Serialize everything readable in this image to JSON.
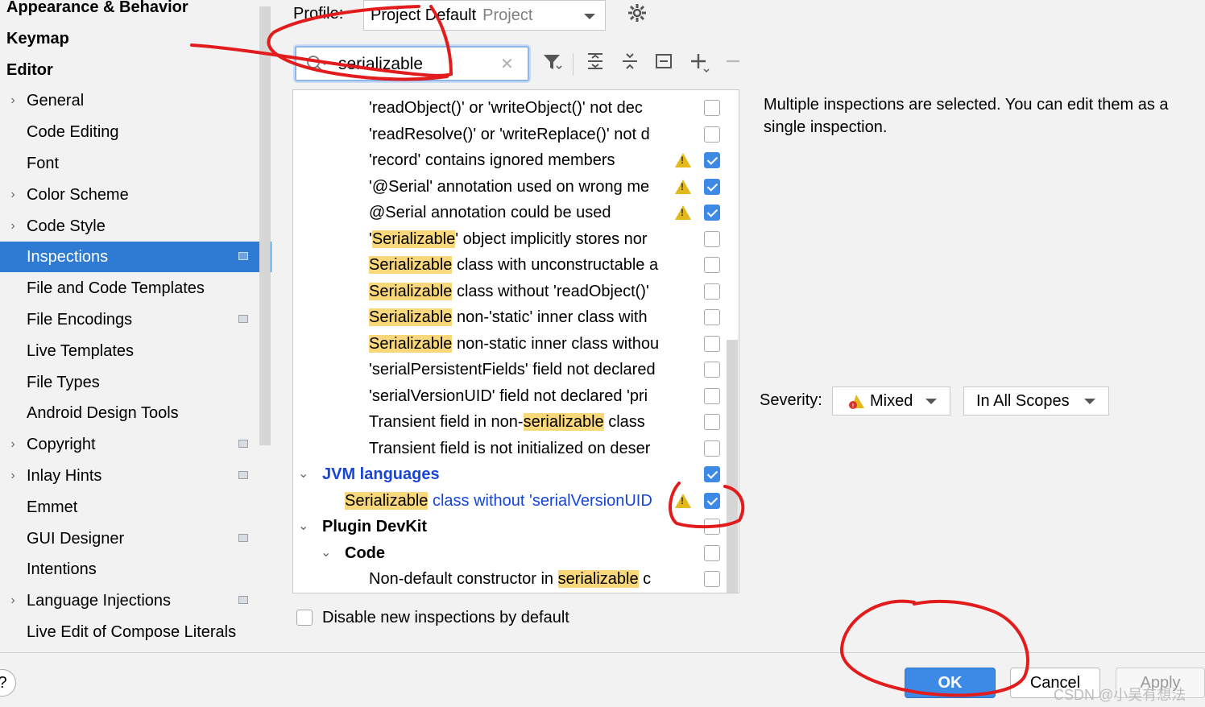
{
  "sidebar": {
    "items": [
      {
        "label": "Appearance & Behavior",
        "level": "top",
        "arrow": "",
        "badge": false
      },
      {
        "label": "Keymap",
        "level": "top",
        "arrow": "",
        "badge": false
      },
      {
        "label": "Editor",
        "level": "top",
        "arrow": "",
        "badge": false
      },
      {
        "label": "General",
        "level": "child",
        "arrow": "›",
        "badge": false
      },
      {
        "label": "Code Editing",
        "level": "child",
        "arrow": "",
        "badge": false
      },
      {
        "label": "Font",
        "level": "child",
        "arrow": "",
        "badge": false
      },
      {
        "label": "Color Scheme",
        "level": "child",
        "arrow": "›",
        "badge": false
      },
      {
        "label": "Code Style",
        "level": "child",
        "arrow": "›",
        "badge": false
      },
      {
        "label": "Inspections",
        "level": "child",
        "arrow": "",
        "badge": true,
        "selected": true
      },
      {
        "label": "File and Code Templates",
        "level": "child",
        "arrow": "",
        "badge": false
      },
      {
        "label": "File Encodings",
        "level": "child",
        "arrow": "",
        "badge": true
      },
      {
        "label": "Live Templates",
        "level": "child",
        "arrow": "",
        "badge": false
      },
      {
        "label": "File Types",
        "level": "child",
        "arrow": "",
        "badge": false
      },
      {
        "label": "Android Design Tools",
        "level": "child",
        "arrow": "",
        "badge": false
      },
      {
        "label": "Copyright",
        "level": "child",
        "arrow": "›",
        "badge": true
      },
      {
        "label": "Inlay Hints",
        "level": "child",
        "arrow": "›",
        "badge": true
      },
      {
        "label": "Emmet",
        "level": "child",
        "arrow": "",
        "badge": false
      },
      {
        "label": "GUI Designer",
        "level": "child",
        "arrow": "",
        "badge": true
      },
      {
        "label": "Intentions",
        "level": "child",
        "arrow": "",
        "badge": false
      },
      {
        "label": "Language Injections",
        "level": "child",
        "arrow": "›",
        "badge": true
      },
      {
        "label": "Live Edit of Compose Literals",
        "level": "child",
        "arrow": "",
        "badge": false
      }
    ]
  },
  "profile": {
    "label": "Profile:",
    "value": "Project Default",
    "sub": "Project",
    "gear_icon": "gear-icon"
  },
  "search": {
    "value": "serializable",
    "search_icon": "search-icon",
    "clear_icon": "close-icon"
  },
  "toolbar": {
    "icons": [
      "filter-icon",
      "expand-all-icon",
      "collapse-all-icon",
      "reset-icon",
      "add-icon",
      "remove-icon"
    ]
  },
  "tree": {
    "rows": [
      {
        "pre": "'readObject()' or 'writeObject()' not dec",
        "hl": "",
        "post": "",
        "indent": "leaf",
        "checked": false,
        "warn": false
      },
      {
        "pre": "'readResolve()' or 'writeReplace()' not d",
        "hl": "",
        "post": "",
        "indent": "leaf",
        "checked": false,
        "warn": false
      },
      {
        "pre": "'record' contains ignored members",
        "hl": "",
        "post": "",
        "indent": "leaf",
        "checked": true,
        "warn": true
      },
      {
        "pre": "'@Serial' annotation used on wrong me",
        "hl": "",
        "post": "",
        "indent": "leaf",
        "checked": true,
        "warn": true
      },
      {
        "pre": "@Serial annotation could be used",
        "hl": "",
        "post": "",
        "indent": "leaf",
        "checked": true,
        "warn": true
      },
      {
        "pre": "'",
        "hl": "Serializable",
        "post": "' object implicitly stores nor",
        "indent": "leaf",
        "checked": false,
        "warn": false
      },
      {
        "pre": "",
        "hl": "Serializable",
        "post": " class with unconstructable a",
        "indent": "leaf",
        "checked": false,
        "warn": false
      },
      {
        "pre": "",
        "hl": "Serializable",
        "post": " class without 'readObject()'",
        "indent": "leaf",
        "checked": false,
        "warn": false
      },
      {
        "pre": "",
        "hl": "Serializable",
        "post": " non-'static' inner class with",
        "indent": "leaf",
        "checked": false,
        "warn": false
      },
      {
        "pre": "",
        "hl": "Serializable",
        "post": " non-static inner class withou",
        "indent": "leaf",
        "checked": false,
        "warn": false
      },
      {
        "pre": "'serialPersistentFields' field not declared",
        "hl": "",
        "post": "",
        "indent": "leaf",
        "checked": false,
        "warn": false
      },
      {
        "pre": "'serialVersionUID' field not declared 'pri",
        "hl": "",
        "post": "",
        "indent": "leaf",
        "checked": false,
        "warn": false
      },
      {
        "pre": "Transient field in non-",
        "hl": "serializable",
        "post": " class",
        "indent": "leaf",
        "checked": false,
        "warn": false
      },
      {
        "pre": "Transient field is not initialized on deser",
        "hl": "",
        "post": "",
        "indent": "leaf",
        "checked": false,
        "warn": false
      },
      {
        "pre": "JVM languages",
        "hl": "",
        "post": "",
        "indent": "group",
        "style": "blue",
        "checked": true,
        "warn": false
      },
      {
        "pre": "",
        "hl": "Serializable",
        "post": " class without 'serialVersionUID",
        "indent": "leaf2",
        "style": "blue-plain",
        "checked": true,
        "warn": true
      },
      {
        "pre": "Plugin DevKit",
        "hl": "",
        "post": "",
        "indent": "group",
        "checked": false,
        "warn": false
      },
      {
        "pre": "Code",
        "hl": "",
        "post": "",
        "indent": "subgroup",
        "checked": false,
        "warn": false
      },
      {
        "pre": "Non-default constructor in ",
        "hl": "serializable",
        "post": " c",
        "indent": "leaf",
        "checked": false,
        "warn": false
      }
    ],
    "disable_new_label": "Disable new inspections by default"
  },
  "detail": {
    "description": "Multiple inspections are selected. You can edit them as a single inspection.",
    "severity_label": "Severity:",
    "severity_value": "Mixed",
    "scope_value": "In All Scopes"
  },
  "footer": {
    "help": "?",
    "ok": "OK",
    "cancel": "Cancel",
    "apply": "Apply",
    "watermark": "CSDN @小吴有想法"
  },
  "colors": {
    "selection": "#2f7bd3",
    "highlight": "#f9d87b",
    "accent": "#3d8ae6",
    "annotation": "#e21c1c"
  }
}
